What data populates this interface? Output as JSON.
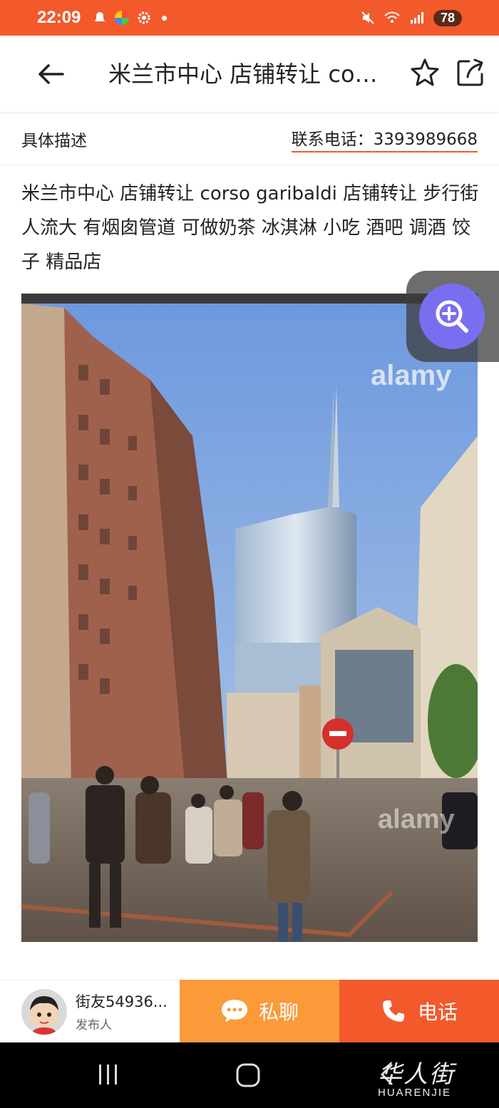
{
  "status_bar": {
    "time": "22:09",
    "battery": "78",
    "accent": "#f25a2c"
  },
  "header": {
    "title": "米兰市中心 店铺转让 corso garibaldi 店铺转让",
    "back_icon": "back-arrow-icon",
    "star_icon": "star-icon",
    "share_icon": "share-icon"
  },
  "info_row": {
    "label": "具体描述",
    "phone_text": "联系电话：3393989668"
  },
  "description": "米兰市中心 店铺转让 corso garibaldi 店铺转让 步行街 人流大 有烟囱管道 可做奶茶 冰淇淋 小吃 酒吧 调酒 饺子 精品店",
  "photo": {
    "watermark": "alamy",
    "zoom_icon": "zoom-in-icon"
  },
  "bottom_bar": {
    "poster_name": "街友54936...",
    "poster_role": "发布人",
    "chat_label": "私聊",
    "call_label": "电话",
    "chat_color": "#fa9a39",
    "call_color": "#f25a2c"
  },
  "system_nav": {
    "brand_cn": "华人街",
    "brand_en": "HUARENJIE"
  }
}
